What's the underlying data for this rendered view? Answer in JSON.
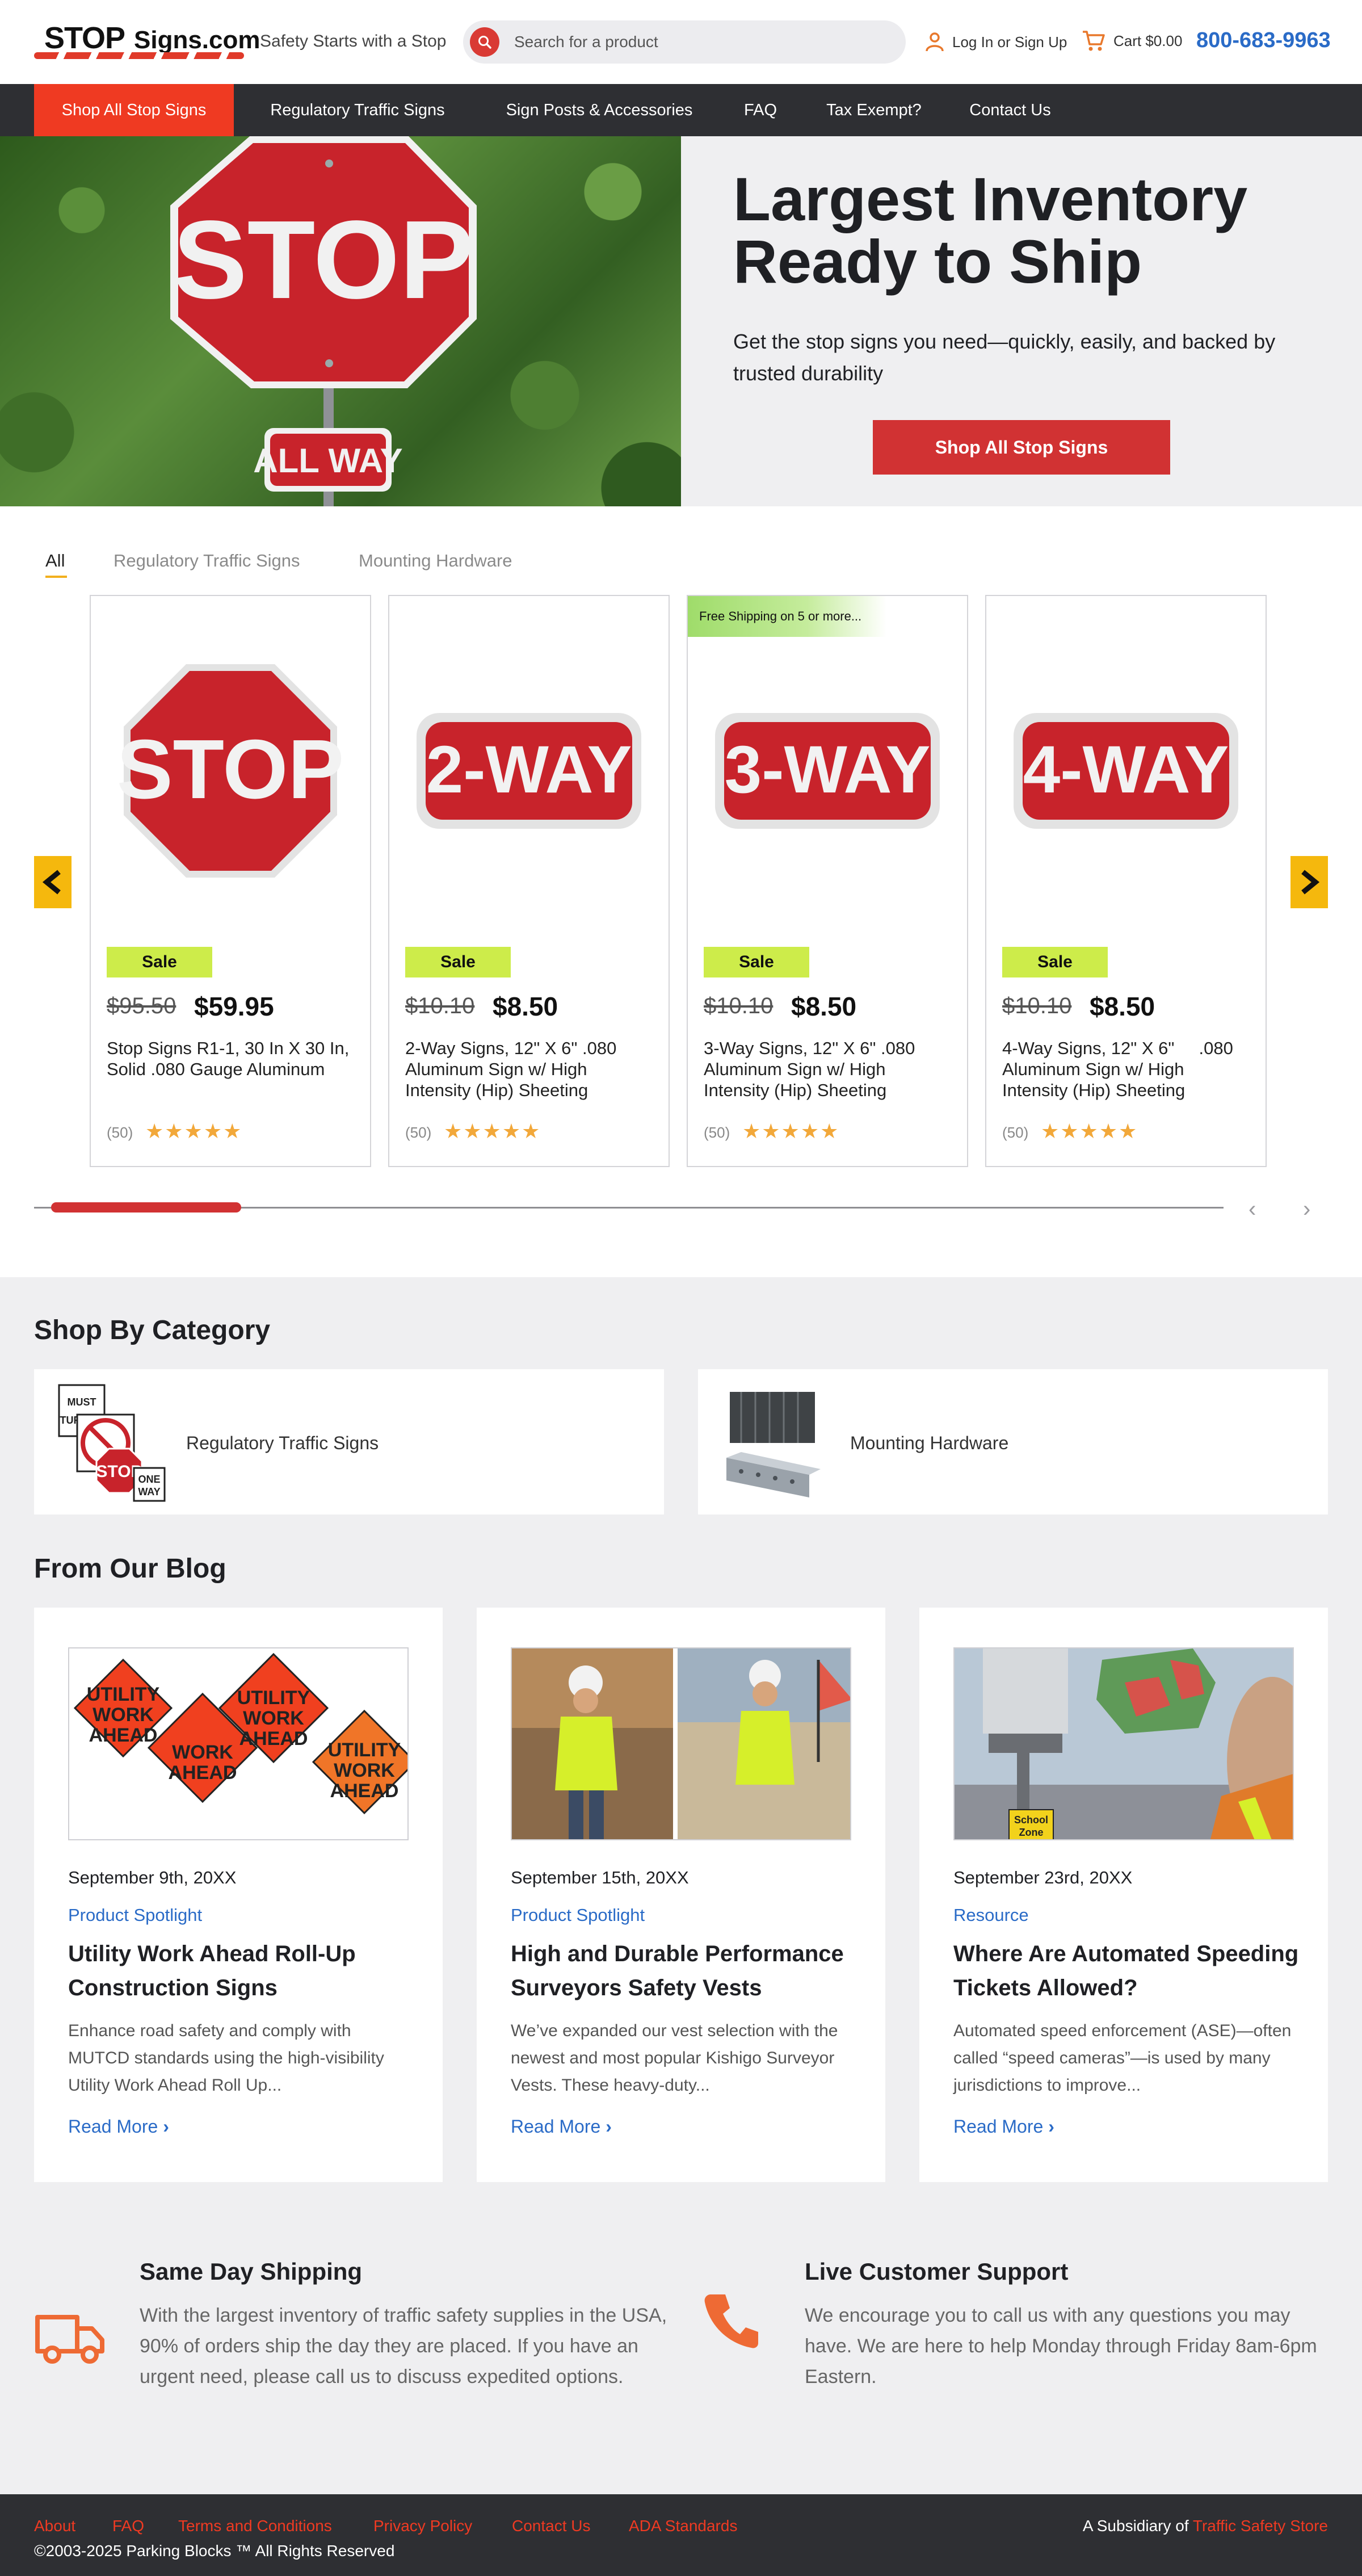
{
  "header": {
    "logo_text_stop": "STOP",
    "logo_text_signs": "Signs.com",
    "tagline": "Safety Starts with a Stop",
    "search_placeholder": "Search for a product",
    "login_label": "Log In or Sign Up",
    "cart_label": "Cart $0.00",
    "phone": "800-683-9963"
  },
  "nav": {
    "items": [
      {
        "label": "Shop All Stop Signs"
      },
      {
        "label": "Regulatory Traffic Signs"
      },
      {
        "label": "Sign Posts & Accessories"
      },
      {
        "label": "FAQ"
      },
      {
        "label": "Tax Exempt?"
      },
      {
        "label": "Contact Us"
      }
    ]
  },
  "hero": {
    "sign_text": "STOP",
    "plate_text": "ALL WAY",
    "title": "Largest Inventory Ready to Ship",
    "subtitle": "Get the stop signs you need—quickly, easily, and backed by trusted durability",
    "button": "Shop All Stop Signs"
  },
  "products": {
    "tabs": [
      "All",
      "Regulatory Traffic Signs",
      "Mounting Hardware"
    ],
    "items": [
      {
        "sign": "STOP",
        "badge": "",
        "sale": "Sale",
        "old_price": "$95.50",
        "price": "$59.95",
        "name": "Stop Signs R1-1, 30 In X 30 In, Solid .080 Gauge Aluminum",
        "reviews": "(50)",
        "stars": "★★★★★"
      },
      {
        "sign": "2-WAY",
        "badge": "",
        "sale": "Sale",
        "old_price": "$10.10",
        "price": "$8.50",
        "name": "2-Way Signs, 12\" X 6\" .080 Aluminum Sign w/ High Intensity (Hip) Sheeting",
        "reviews": "(50)",
        "stars": "★★★★★"
      },
      {
        "sign": "3-WAY",
        "badge": "Free Shipping on 5 or more...",
        "sale": "Sale",
        "old_price": "$10.10",
        "price": "$8.50",
        "name": "3-Way Signs, 12\" X 6\" .080 Aluminum Sign w/ High Intensity (Hip) Sheeting",
        "reviews": "(50)",
        "stars": "★★★★★"
      },
      {
        "sign": "4-WAY",
        "badge": "",
        "sale": "Sale",
        "old_price": "$10.10",
        "price": "$8.50",
        "name": "4-Way Signs, 12\" X 6\"     .080 Aluminum Sign w/ High Intensity (Hip) Sheeting",
        "reviews": "(50)",
        "stars": "★★★★★"
      }
    ],
    "carousel_progress_fraction": 0.16
  },
  "categories": {
    "heading": "Shop By Category",
    "items": [
      {
        "label": "Regulatory Traffic Signs"
      },
      {
        "label": "Mounting Hardware"
      }
    ]
  },
  "blog": {
    "heading": "From Our Blog",
    "posts": [
      {
        "date": "September 9th, 20XX",
        "category": "Product Spotlight",
        "title": "Utility Work Ahead Roll-Up Construction Signs",
        "excerpt": "Enhance road safety and comply with MUTCD standards using the high-visibility Utility Work Ahead Roll Up...",
        "more": "Read More"
      },
      {
        "date": "September 15th, 20XX",
        "category": "Product Spotlight",
        "title": "High and Durable Performance Surveyors Safety Vests",
        "excerpt": "We’ve expanded our vest selection with the newest and most popular Kishigo Surveyor Vests. These heavy-duty...",
        "more": "Read More"
      },
      {
        "date": "September 23rd, 20XX",
        "category": "Resource",
        "title": "Where Are Automated Speeding Tickets Allowed?",
        "excerpt": "Automated speed enforcement (ASE)—often called “speed cameras”—is used by many jurisdictions to improve...",
        "more": "Read More"
      }
    ],
    "utility_sign_line1": "UTILITY",
    "utility_sign_line2": "WORK",
    "utility_sign_line3": "AHEAD",
    "school_zone_line1": "School",
    "school_zone_line2": "Zone"
  },
  "features": {
    "shipping": {
      "title": "Same Day Shipping",
      "text": "With the largest inventory of traffic safety supplies in the USA, 90% of orders ship the day they are placed. If you have an urgent need, please call us to discuss expedited options."
    },
    "support": {
      "title": "Live Customer Support",
      "text": "We encourage you to call us with any questions you may have. We are here to help Monday through Friday 8am-6pm Eastern."
    }
  },
  "footer": {
    "links": [
      "About",
      "FAQ",
      "Terms and Conditions",
      "Privacy Policy",
      "Contact Us",
      "ADA Standards"
    ],
    "copyright": "©2003-2025 Parking Blocks ™ All Rights Reserved",
    "subsidiary_prefix": "A Subsidiary of ",
    "subsidiary_link": "Traffic Safety Store"
  },
  "colors": {
    "brand_red": "#d13233",
    "nav_active": "#ef3a22",
    "link_blue": "#2a6bc7",
    "sale_green": "#cdec4a",
    "arrow_yellow": "#f5b80d",
    "dark_bar": "#2e2f33"
  },
  "icons": [
    "search-icon",
    "user-icon",
    "cart-icon",
    "chevron-left-icon",
    "chevron-right-icon",
    "truck-icon",
    "phone-icon",
    "star-icon"
  ]
}
